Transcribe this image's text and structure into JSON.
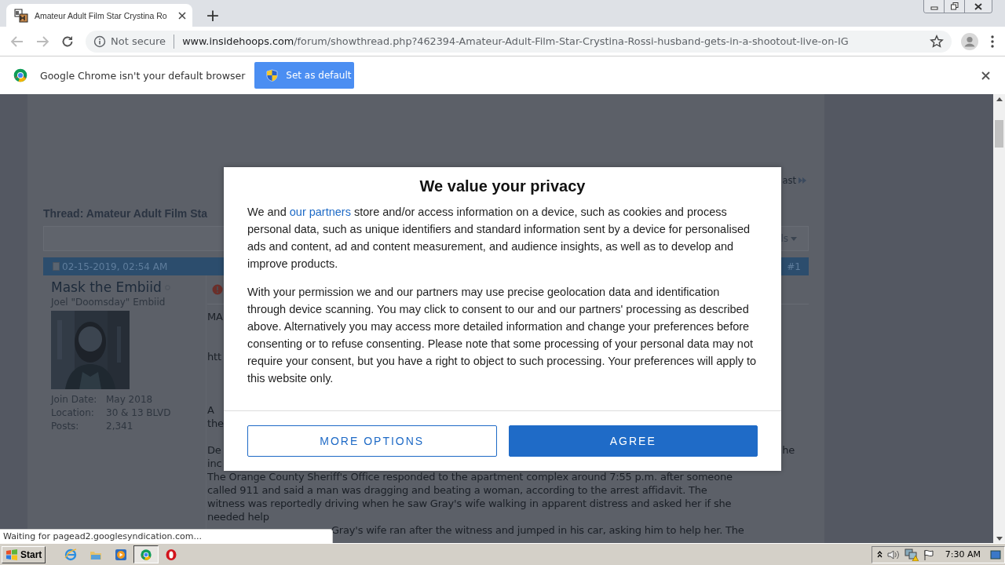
{
  "browser": {
    "tab": {
      "title": "Amateur Adult Film Star Crystina Ro",
      "selected": true
    },
    "new_tab": "+",
    "address": {
      "security": "Not secure",
      "host": "www.insidehoops.com",
      "path": "/forum/showthread.php?462394-Amateur-Adult-Film-Star-Crystina-Rossi-husband-gets-in-a-shootout-live-on-IG"
    },
    "infobar": {
      "message": "Google Chrome isn't your default browser",
      "button": "Set as default"
    }
  },
  "forum": {
    "nav_fragment": "ast",
    "thread_title": "Thread: Amateur Adult Film Sta",
    "tools_fragment": "ls",
    "post": {
      "date": "02-15-2019, 02:54 AM",
      "number": "#1",
      "author": "Mask the Embiid",
      "online": false,
      "user_title": "Joel \"Doomsday\" Embiid",
      "stats": [
        {
          "label": "Join Date:",
          "value": "May 2018"
        },
        {
          "label": "Location:",
          "value": "30 & 13 BLVD"
        },
        {
          "label": "Posts:",
          "value": "2,341"
        }
      ],
      "body": [
        {
          "kind": "text",
          "text": "MA"
        },
        {
          "kind": "text",
          "text": "htt"
        },
        {
          "kind": "text",
          "text": "A"
        },
        {
          "kind": "text",
          "text": "the"
        },
        {
          "kind": "split",
          "left": "De",
          "right": "he"
        },
        {
          "kind": "text",
          "text": "inc"
        },
        {
          "kind": "text",
          "text": "The Orange County Sheriff's Office responded to the apartment complex around 7:55 p.m. after someone"
        },
        {
          "kind": "text",
          "text": "called 911 and said a man was dragging and beating a woman, according to the arrest affidavit. The"
        },
        {
          "kind": "text",
          "text": "witness was reportedly driving when he saw Gray's wife walking in apparent distress and asked her if she"
        },
        {
          "kind": "text",
          "text": "needed help"
        },
        {
          "kind": "tail",
          "text": "Gray's wife ran after the witness and jumped in his car, asking him to help her. The"
        }
      ]
    }
  },
  "consent": {
    "title": "We value your privacy",
    "paragraphs": [
      {
        "before": "We and ",
        "link": "our partners",
        "after": " store and/or access information on a device, such as cookies and process personal data, such as unique identifiers and standard information sent by a device for personalised ads and content, ad and content measurement, and audience insights, as well as to develop and improve products."
      },
      {
        "before": "With your permission we and our partners may use precise geolocation data and identification through device scanning. You may click to consent to our and our partners' processing as described above. Alternatively you may access more detailed information and change your preferences before consenting or to refuse consenting. Please note that some processing of your personal data may not require your consent, but you have a right to object to such processing. Your preferences will apply to this website only."
      }
    ],
    "buttons": [
      {
        "label": "MORE OPTIONS",
        "kind": "outline"
      },
      {
        "label": "AGREE",
        "kind": "primary"
      }
    ]
  },
  "status": "Waiting for pagead2.googlesyndication.com...",
  "taskbar": {
    "start": "Start",
    "apps": [
      {
        "kind": "ie",
        "selected": false
      },
      {
        "kind": "folder",
        "selected": false
      },
      {
        "kind": "media",
        "selected": false
      },
      {
        "kind": "chrome",
        "selected": true
      },
      {
        "kind": "opera",
        "selected": false
      }
    ],
    "clock": "7:30 AM"
  }
}
